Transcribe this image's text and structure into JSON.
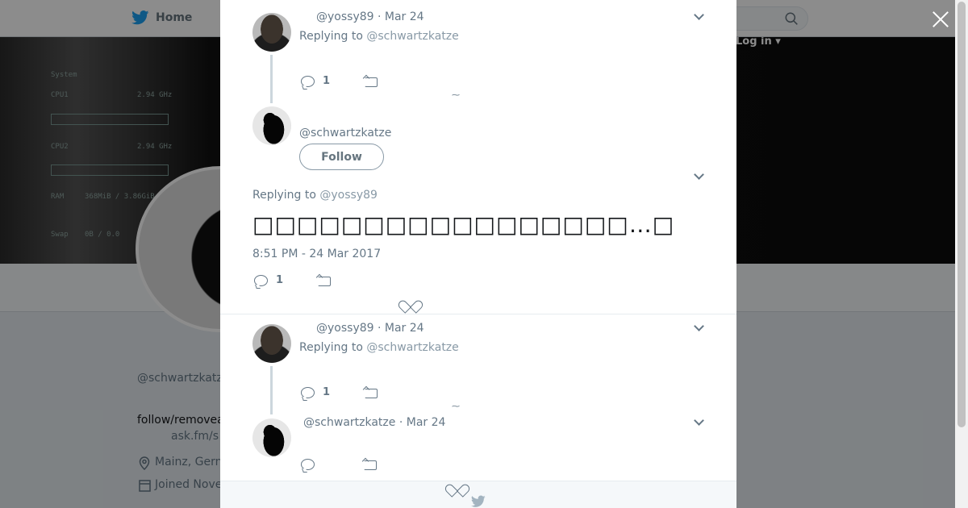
{
  "background": {
    "nav": {
      "home_label": "Home",
      "login_label": "Log in"
    },
    "profile": {
      "handle_partial": "@schwartzkatz",
      "bio_partial": "follow/removea",
      "link_partial": "ask.fm/s",
      "location_partial": "Mainz, Gern",
      "joined_partial": "Joined Nove"
    },
    "monitor": {
      "title": "System",
      "cpu1_label": "CPU1",
      "cpu1_value": "2.94 GHz",
      "cpu2_label": "CPU2",
      "cpu2_value": "2.94 GHz",
      "ram_label": "RAM",
      "ram_value": "368MiB / 3.86GiB",
      "swap_label": "Swap",
      "swap_value": "0B / 0.0"
    }
  },
  "modal": {
    "tweet1": {
      "handle": "@yossy89",
      "date": "· Mar 24",
      "replying_prefix": "Replying to",
      "replying_to": "@schwartzkatze",
      "reply_count": "1"
    },
    "main_tweet": {
      "handle": "@schwartzkatze",
      "follow_label": "Follow",
      "replying_prefix": "Replying to",
      "replying_to": "@yossy89",
      "text": "□□□□□□□□□□□□□□□□□…□",
      "timestamp": "8:51 PM - 24 Mar 2017",
      "reply_count": "1"
    },
    "tweet3": {
      "handle": "@yossy89",
      "date": "· Mar 24",
      "replying_prefix": "Replying to",
      "replying_to": "@schwartzkatze",
      "reply_count": "1"
    },
    "tweet4": {
      "handle": "@schwartzkatze",
      "date": "· Mar 24"
    }
  },
  "colors": {
    "brand": "#1da1f2",
    "muted": "#657786"
  }
}
